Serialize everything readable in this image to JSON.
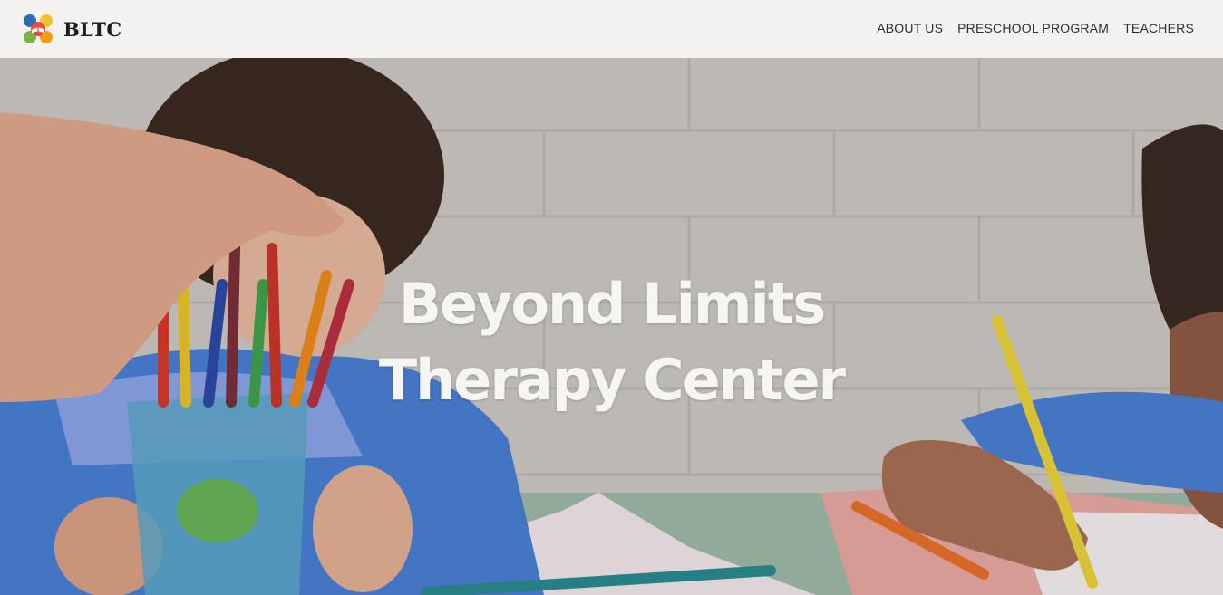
{
  "brand": {
    "name": "BLTC",
    "logo_icon": "puzzle-book-logo-icon",
    "logo_colors": [
      "#2d6bb4",
      "#f2c12e",
      "#e84c3d",
      "#7cb342",
      "#f39c12"
    ]
  },
  "nav": {
    "items": [
      {
        "label": "ABOUT US"
      },
      {
        "label": "PRESCHOOL PROGRAM"
      },
      {
        "label": "TEACHERS"
      }
    ]
  },
  "hero": {
    "title_line1": "Beyond Limits",
    "title_line2": "Therapy Center",
    "image": "children-drawing-with-colored-pencils-photo"
  },
  "colors": {
    "header_bg": "#f3f2f1",
    "title_text": "#f7f5f2"
  }
}
